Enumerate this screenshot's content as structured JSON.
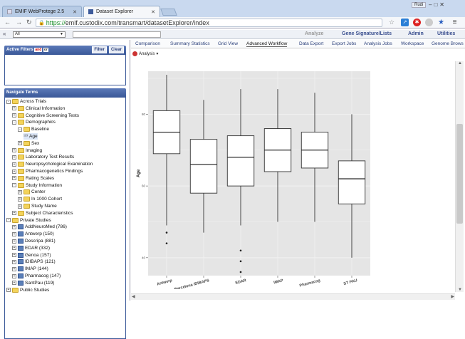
{
  "browser": {
    "tabs": [
      {
        "label": "EMIF WebProtege 2.5",
        "active": false
      },
      {
        "label": "Dataset Explorer",
        "active": true
      }
    ],
    "user": "Rudi",
    "url_protocol": "https://",
    "url_rest": "emif.custodix.com/transmart/datasetExplorer/index"
  },
  "appbar": {
    "collapse_label": "«",
    "dropdown_value": "All",
    "menu": [
      {
        "label": "Analyze",
        "dim": true
      },
      {
        "label": "Gene Signature/Lists",
        "dim": false
      },
      {
        "label": "Admin",
        "dim": false
      },
      {
        "label": "Utilities",
        "dim": false
      }
    ]
  },
  "filters": {
    "title": "Active Filters",
    "and_label": "and",
    "or_label": "or",
    "filter_button": "Filter",
    "clear_button": "Clear"
  },
  "navigate": {
    "title": "Navigate Terms",
    "nodes": [
      {
        "label": "Across Trials",
        "level": 0,
        "type": "folder",
        "exp": "-"
      },
      {
        "label": "Clinical Information",
        "level": 1,
        "type": "folder",
        "exp": "+"
      },
      {
        "label": "Cognitive Screening Tests",
        "level": 1,
        "type": "folder",
        "exp": "+"
      },
      {
        "label": "Demographics",
        "level": 1,
        "type": "folder",
        "exp": "-"
      },
      {
        "label": "Baseline",
        "level": 2,
        "type": "folder",
        "exp": "-"
      },
      {
        "label": "Age",
        "level": 3,
        "type": "leaf",
        "exp": "",
        "selected": true
      },
      {
        "label": "Sex",
        "level": 2,
        "type": "folder",
        "exp": "+"
      },
      {
        "label": "Imaging",
        "level": 1,
        "type": "folder",
        "exp": "+"
      },
      {
        "label": "Laboratory Test Results",
        "level": 1,
        "type": "folder",
        "exp": "+"
      },
      {
        "label": "Neuropsychological Examination",
        "level": 1,
        "type": "folder",
        "exp": "+"
      },
      {
        "label": "Pharmacogenetics Findings",
        "level": 1,
        "type": "folder",
        "exp": "+"
      },
      {
        "label": "Rating Scales",
        "level": 1,
        "type": "folder",
        "exp": "+"
      },
      {
        "label": "Study Information",
        "level": 1,
        "type": "folder",
        "exp": "-"
      },
      {
        "label": "Center",
        "level": 2,
        "type": "folder",
        "exp": "+"
      },
      {
        "label": "In 1000 Cohort",
        "level": 2,
        "type": "folder",
        "exp": "+"
      },
      {
        "label": "Study Name",
        "level": 2,
        "type": "folder",
        "exp": "+"
      },
      {
        "label": "Subject Characteristics",
        "level": 1,
        "type": "folder",
        "exp": "+"
      },
      {
        "label": "Private Studies",
        "level": 0,
        "type": "folder",
        "exp": "-"
      },
      {
        "label": "AddNeuroMed (786)",
        "level": 1,
        "type": "study",
        "exp": "+"
      },
      {
        "label": "Antwerp (150)",
        "level": 1,
        "type": "study",
        "exp": "+"
      },
      {
        "label": "Descripa (881)",
        "level": 1,
        "type": "study",
        "exp": "+"
      },
      {
        "label": "EDAR (332)",
        "level": 1,
        "type": "study",
        "exp": "+"
      },
      {
        "label": "Genoa (157)",
        "level": 1,
        "type": "study",
        "exp": "+"
      },
      {
        "label": "IDIBAPS (121)",
        "level": 1,
        "type": "study",
        "exp": "+"
      },
      {
        "label": "IMAP (144)",
        "level": 1,
        "type": "study",
        "exp": "+"
      },
      {
        "label": "Pharmacog (147)",
        "level": 1,
        "type": "study",
        "exp": "+"
      },
      {
        "label": "SantPau (119)",
        "level": 1,
        "type": "study",
        "exp": "+"
      },
      {
        "label": "Public Studies",
        "level": 0,
        "type": "folder",
        "exp": "+"
      }
    ]
  },
  "main": {
    "tabs": [
      "Comparison",
      "Summary Statistics",
      "Grid View",
      "Advanced Workflow",
      "Data Export",
      "Export Jobs",
      "Analysis Jobs",
      "Workspace",
      "Genome Brows"
    ],
    "active_tab": "Advanced Workflow",
    "analysis_label": "Analysis"
  },
  "chart_data": {
    "type": "boxplot",
    "title": "",
    "xlabel": "",
    "ylabel": "Age",
    "ylim": [
      35,
      92
    ],
    "y_ticks": [
      40,
      60,
      80
    ],
    "grid": true,
    "categories": [
      "Antwerp",
      "Barcelona IDIBAPS",
      "EDAR",
      "IMAP",
      "Pharmacog",
      "ST PAU"
    ],
    "boxes": [
      {
        "name": "Antwerp",
        "whisker_low": 49,
        "q1": 69,
        "median": 75,
        "q3": 81,
        "whisker_high": 91,
        "outliers": [
          47,
          44
        ]
      },
      {
        "name": "Barcelona IDIBAPS",
        "whisker_low": 47,
        "q1": 58,
        "median": 66,
        "q3": 73,
        "whisker_high": 84
      },
      {
        "name": "EDAR",
        "whisker_low": 49,
        "q1": 60,
        "median": 68,
        "q3": 74,
        "whisker_high": 87,
        "outliers": [
          42,
          39,
          36
        ]
      },
      {
        "name": "IMAP",
        "whisker_low": 50,
        "q1": 64,
        "median": 70,
        "q3": 76,
        "whisker_high": 87
      },
      {
        "name": "Pharmacog",
        "whisker_low": 50,
        "q1": 65,
        "median": 70,
        "q3": 75,
        "whisker_high": 86
      },
      {
        "name": "ST PAU",
        "whisker_low": 40,
        "q1": 55,
        "median": 62,
        "q3": 67,
        "whisker_high": 80
      }
    ]
  },
  "colors": {
    "plot_bg": "#e5e5e5",
    "grid": "#ffffff",
    "box_fill": "#ffffff",
    "box_stroke": "#333333",
    "panel_header": "#3c5a9a",
    "chrome": "#c9d9ef"
  }
}
